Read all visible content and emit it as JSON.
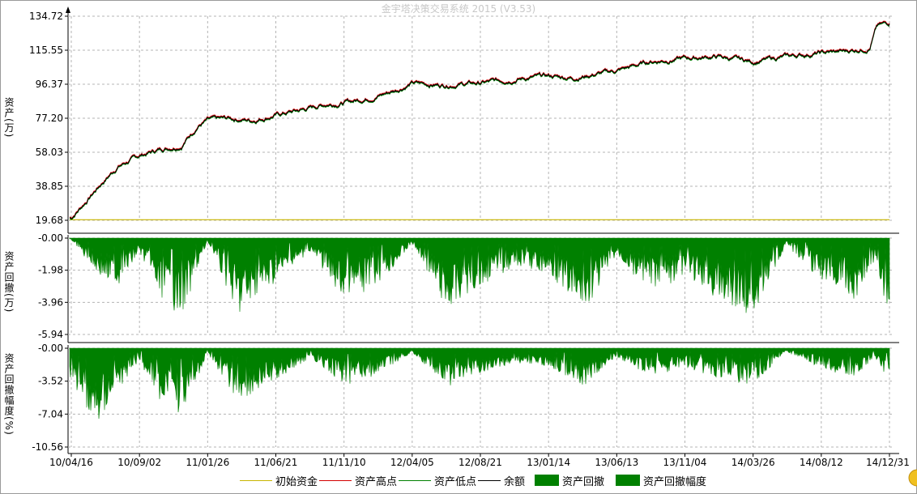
{
  "window": {
    "title": "金宇塔决策交易系统 2015 (V3.53)"
  },
  "colors": {
    "initial_capital": "#c8b400",
    "asset_high": "#d40000",
    "asset_low": "#008000",
    "balance": "#000000",
    "drawdown_fill": "#008000",
    "grid": "#b4b4b4"
  },
  "legend": [
    {
      "label": "初始资金",
      "type": "line",
      "color": "#c8b400"
    },
    {
      "label": "资产高点",
      "type": "line",
      "color": "#d40000"
    },
    {
      "label": "资产低点",
      "type": "line",
      "color": "#008000"
    },
    {
      "label": "余额",
      "type": "line",
      "color": "#000000"
    },
    {
      "label": "资产回撤",
      "type": "box",
      "color": "#008000"
    },
    {
      "label": "资产回撤幅度",
      "type": "box",
      "color": "#008000"
    }
  ],
  "chart_data": [
    {
      "type": "line",
      "ylabel": "资产(万)",
      "yticks": [
        "134.72",
        "115.55",
        "96.37",
        "77.20",
        "58.03",
        "38.85",
        "19.68"
      ],
      "ylim": [
        19.68,
        134.72
      ],
      "grid": true,
      "x_ticks": [
        "10/04/16",
        "10/09/02",
        "11/01/26",
        "11/06/21",
        "11/11/10",
        "12/04/05",
        "12/08/21",
        "13/01/14",
        "13/06/13",
        "13/11/04",
        "14/03/26",
        "14/08/12",
        "14/12/31"
      ],
      "initial_capital": 20,
      "series": [
        {
          "name": "余额",
          "x": [
            "10/04/16",
            "10/05/15",
            "10/06/15",
            "10/07/20",
            "10/09/02",
            "10/10/20",
            "10/12/01",
            "11/01/05",
            "11/01/26",
            "11/03/15",
            "11/05/01",
            "11/06/21",
            "11/08/15",
            "11/10/01",
            "11/11/10",
            "12/01/10",
            "12/03/01",
            "12/04/05",
            "12/06/01",
            "12/08/21",
            "12/10/20",
            "13/01/14",
            "13/03/10",
            "13/06/13",
            "13/08/20",
            "13/11/04",
            "14/01/10",
            "14/03/26",
            "14/06/01",
            "14/08/12",
            "14/10/01",
            "14/11/20",
            "14/12/05",
            "14/12/31"
          ],
          "values": [
            21,
            30,
            40,
            50,
            56,
            60,
            62,
            73,
            76,
            77,
            76,
            79,
            82,
            85,
            86,
            89,
            93,
            97,
            96,
            97,
            99,
            101,
            100,
            104,
            109,
            111,
            112,
            109,
            112,
            114,
            115,
            117,
            129,
            131
          ]
        }
      ]
    },
    {
      "type": "area",
      "ylabel": "资产回撤(万)",
      "yticks": [
        "-0.00",
        "-1.98",
        "-3.96",
        "-5.94"
      ],
      "ylim": [
        -5.94,
        0
      ],
      "grid": true,
      "series": [
        {
          "name": "资产回撤",
          "x": [
            "10/04/16",
            "10/06/01",
            "10/07/15",
            "10/09/02",
            "10/10/15",
            "10/12/01",
            "11/01/26",
            "11/04/01",
            "11/06/21",
            "11/09/01",
            "11/11/10",
            "12/01/20",
            "12/04/05",
            "12/06/15",
            "12/08/21",
            "12/11/01",
            "13/01/14",
            "13/04/01",
            "13/06/13",
            "13/08/25",
            "13/11/04",
            "14/01/15",
            "14/03/26",
            "14/06/01",
            "14/08/12",
            "14/10/20",
            "14/12/01",
            "14/12/31"
          ],
          "values": [
            -0.1,
            -1.8,
            -3.0,
            -0.8,
            -3.5,
            -4.7,
            -0.2,
            -4.5,
            -2.6,
            -0.8,
            -3.6,
            -2.9,
            -0.3,
            -4.2,
            -2.8,
            -1.7,
            -2.0,
            -4.6,
            -1.0,
            -3.4,
            -2.2,
            -3.7,
            -4.8,
            -0.4,
            -2.5,
            -3.7,
            -1.3,
            -4.8
          ]
        }
      ]
    },
    {
      "type": "area",
      "ylabel": "资产回撤幅度(%)",
      "yticks": [
        "-0.00",
        "-3.52",
        "-7.04",
        "-10.56"
      ],
      "ylim": [
        -10.56,
        0
      ],
      "grid": true,
      "series": [
        {
          "name": "资产回撤幅度",
          "x": [
            "10/04/16",
            "10/06/01",
            "10/07/15",
            "10/09/02",
            "10/10/15",
            "10/12/01",
            "11/01/26",
            "11/04/01",
            "11/06/21",
            "11/09/01",
            "11/11/10",
            "12/01/20",
            "12/04/05",
            "12/06/15",
            "12/08/21",
            "12/11/01",
            "13/01/14",
            "13/04/01",
            "13/06/13",
            "13/08/25",
            "13/11/04",
            "14/01/15",
            "14/03/26",
            "14/06/01",
            "14/08/12",
            "14/10/20",
            "14/12/01",
            "14/12/31"
          ],
          "values": [
            -3.0,
            -8.2,
            -4.5,
            -1.5,
            -5.2,
            -7.0,
            -0.5,
            -5.5,
            -3.2,
            -1.0,
            -3.8,
            -2.8,
            -0.4,
            -4.0,
            -2.6,
            -1.5,
            -1.8,
            -4.0,
            -0.9,
            -3.0,
            -1.9,
            -3.2,
            -3.9,
            -0.3,
            -2.1,
            -3.0,
            -1.0,
            -3.5
          ]
        }
      ]
    }
  ]
}
